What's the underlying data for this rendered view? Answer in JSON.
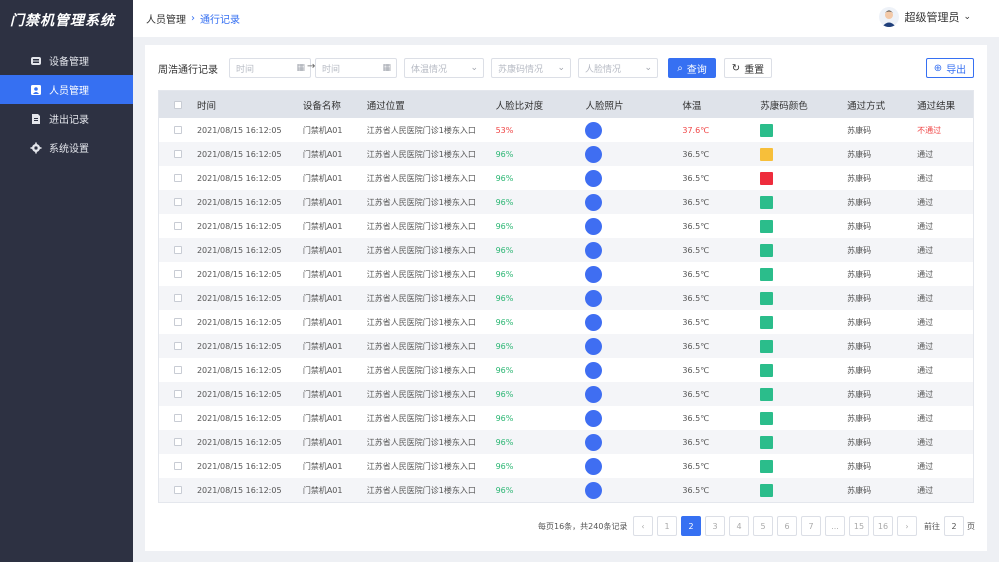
{
  "app": {
    "title": "门禁机管理系统"
  },
  "sidebar": {
    "items": [
      {
        "label": "设备管理",
        "icon": "device-icon",
        "active": false
      },
      {
        "label": "人员管理",
        "icon": "person-icon",
        "active": true
      },
      {
        "label": "进出记录",
        "icon": "record-icon",
        "active": false
      },
      {
        "label": "系统设置",
        "icon": "gear-icon",
        "active": false
      }
    ]
  },
  "header": {
    "breadcrumb": [
      "人员管理",
      "通行记录"
    ],
    "user": "超级管理员"
  },
  "toolbar": {
    "label": "周浩通行记录",
    "start_placeholder": "时间",
    "end_placeholder": "时间",
    "temp_placeholder": "体温情况",
    "code_placeholder": "苏康码情况",
    "face_placeholder": "人脸情况",
    "search_label": "查询",
    "reset_label": "重置",
    "export_label": "导出"
  },
  "table": {
    "headers": [
      "时间",
      "设备名称",
      "通过位置",
      "人脸比对度",
      "人脸照片",
      "体温",
      "苏康码颜色",
      "通过方式",
      "通过结果"
    ],
    "rows": [
      {
        "time": "2021/08/15  16:12:05",
        "device": "门禁机A01",
        "position": "江苏省人民医院门诊1楼东入口",
        "similarity": "53%",
        "temp": "37.6℃",
        "code_color": "#2bbd8b",
        "mode": "苏康码",
        "result": "不通过",
        "alert": true
      },
      {
        "time": "2021/08/15  16:12:05",
        "device": "门禁机A01",
        "position": "江苏省人民医院门诊1楼东入口",
        "similarity": "96%",
        "temp": "36.5℃",
        "code_color": "#f7bf3a",
        "mode": "苏康码",
        "result": "通过",
        "alert": false
      },
      {
        "time": "2021/08/15  16:12:05",
        "device": "门禁机A01",
        "position": "江苏省人民医院门诊1楼东入口",
        "similarity": "96%",
        "temp": "36.5℃",
        "code_color": "#ee2c3c",
        "mode": "苏康码",
        "result": "通过",
        "alert": false
      },
      {
        "time": "2021/08/15  16:12:05",
        "device": "门禁机A01",
        "position": "江苏省人民医院门诊1楼东入口",
        "similarity": "96%",
        "temp": "36.5℃",
        "code_color": "#2bbd8b",
        "mode": "苏康码",
        "result": "通过",
        "alert": false
      },
      {
        "time": "2021/08/15  16:12:05",
        "device": "门禁机A01",
        "position": "江苏省人民医院门诊1楼东入口",
        "similarity": "96%",
        "temp": "36.5℃",
        "code_color": "#2bbd8b",
        "mode": "苏康码",
        "result": "通过",
        "alert": false
      },
      {
        "time": "2021/08/15  16:12:05",
        "device": "门禁机A01",
        "position": "江苏省人民医院门诊1楼东入口",
        "similarity": "96%",
        "temp": "36.5℃",
        "code_color": "#2bbd8b",
        "mode": "苏康码",
        "result": "通过",
        "alert": false
      },
      {
        "time": "2021/08/15  16:12:05",
        "device": "门禁机A01",
        "position": "江苏省人民医院门诊1楼东入口",
        "similarity": "96%",
        "temp": "36.5℃",
        "code_color": "#2bbd8b",
        "mode": "苏康码",
        "result": "通过",
        "alert": false
      },
      {
        "time": "2021/08/15  16:12:05",
        "device": "门禁机A01",
        "position": "江苏省人民医院门诊1楼东入口",
        "similarity": "96%",
        "temp": "36.5℃",
        "code_color": "#2bbd8b",
        "mode": "苏康码",
        "result": "通过",
        "alert": false
      },
      {
        "time": "2021/08/15  16:12:05",
        "device": "门禁机A01",
        "position": "江苏省人民医院门诊1楼东入口",
        "similarity": "96%",
        "temp": "36.5℃",
        "code_color": "#2bbd8b",
        "mode": "苏康码",
        "result": "通过",
        "alert": false
      },
      {
        "time": "2021/08/15  16:12:05",
        "device": "门禁机A01",
        "position": "江苏省人民医院门诊1楼东入口",
        "similarity": "96%",
        "temp": "36.5℃",
        "code_color": "#2bbd8b",
        "mode": "苏康码",
        "result": "通过",
        "alert": false
      },
      {
        "time": "2021/08/15  16:12:05",
        "device": "门禁机A01",
        "position": "江苏省人民医院门诊1楼东入口",
        "similarity": "96%",
        "temp": "36.5℃",
        "code_color": "#2bbd8b",
        "mode": "苏康码",
        "result": "通过",
        "alert": false
      },
      {
        "time": "2021/08/15  16:12:05",
        "device": "门禁机A01",
        "position": "江苏省人民医院门诊1楼东入口",
        "similarity": "96%",
        "temp": "36.5℃",
        "code_color": "#2bbd8b",
        "mode": "苏康码",
        "result": "通过",
        "alert": false
      },
      {
        "time": "2021/08/15  16:12:05",
        "device": "门禁机A01",
        "position": "江苏省人民医院门诊1楼东入口",
        "similarity": "96%",
        "temp": "36.5℃",
        "code_color": "#2bbd8b",
        "mode": "苏康码",
        "result": "通过",
        "alert": false
      },
      {
        "time": "2021/08/15  16:12:05",
        "device": "门禁机A01",
        "position": "江苏省人民医院门诊1楼东入口",
        "similarity": "96%",
        "temp": "36.5℃",
        "code_color": "#2bbd8b",
        "mode": "苏康码",
        "result": "通过",
        "alert": false
      },
      {
        "time": "2021/08/15  16:12:05",
        "device": "门禁机A01",
        "position": "江苏省人民医院门诊1楼东入口",
        "similarity": "96%",
        "temp": "36.5℃",
        "code_color": "#2bbd8b",
        "mode": "苏康码",
        "result": "通过",
        "alert": false
      },
      {
        "time": "2021/08/15  16:12:05",
        "device": "门禁机A01",
        "position": "江苏省人民医院门诊1楼东入口",
        "similarity": "96%",
        "temp": "36.5℃",
        "code_color": "#2bbd8b",
        "mode": "苏康码",
        "result": "通过",
        "alert": false
      }
    ]
  },
  "pagination": {
    "info": "每页16条，共240条记录",
    "prev": "‹",
    "next": "›",
    "pages": [
      "1",
      "2",
      "3",
      "4",
      "5",
      "6",
      "7",
      "...",
      "15",
      "16"
    ],
    "current": "2",
    "goto_prefix": "前往",
    "goto_value": "2",
    "goto_suffix": "页"
  },
  "colors": {
    "primary": "#3670f2",
    "sidebar": "#2d3142",
    "alert": "#f04646",
    "ok": "#2bb673"
  }
}
